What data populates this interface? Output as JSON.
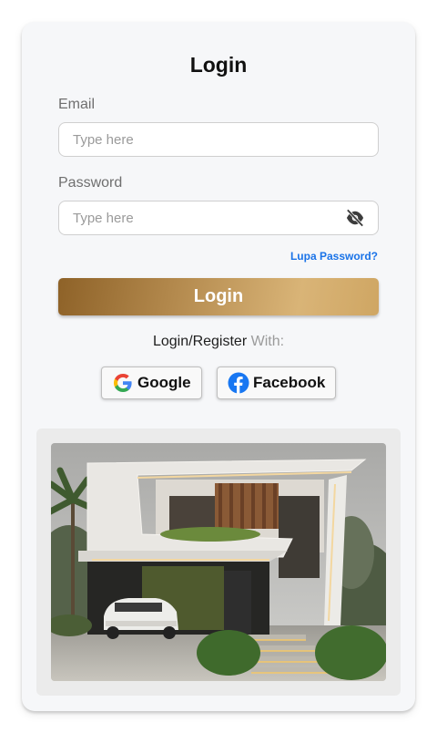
{
  "form": {
    "title": "Login",
    "email_label": "Email",
    "email_placeholder": "Type here",
    "password_label": "Password",
    "password_placeholder": "Type here",
    "forgot_password": "Lupa Password?",
    "login_button": "Login",
    "social_prefix": "Login/Register",
    "social_suffix": " With:"
  },
  "social": {
    "google_label": "Google",
    "facebook_label": "Facebook"
  },
  "colors": {
    "accent_gold": "#b2884c",
    "link_blue": "#1a73e8",
    "facebook_blue": "#1877f2"
  },
  "icons": {
    "password_toggle": "eye-off-icon",
    "google": "google-g-icon",
    "facebook": "facebook-f-icon"
  }
}
